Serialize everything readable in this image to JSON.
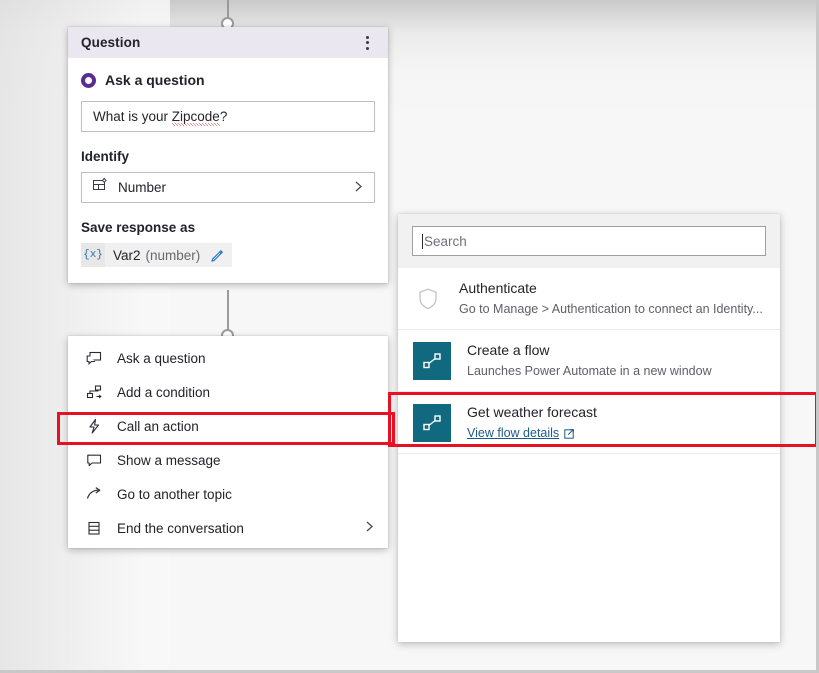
{
  "question_card": {
    "title": "Question",
    "menu_icon": "kebab-menu-icon",
    "ask_option": {
      "label": "Ask a question",
      "selected": true
    },
    "question_text": {
      "value": "What is your Zipcode?",
      "misspelled_word": "Zipcode"
    },
    "identify": {
      "label": "Identify",
      "selected_value": "Number",
      "icon": "entity-grid-icon",
      "chevron": "chevron-right-icon"
    },
    "save_response": {
      "label": "Save response as",
      "badge": "{x}",
      "variable_name": "Var2",
      "variable_type": "(number)",
      "edit_icon": "pencil-icon"
    }
  },
  "node_menu": {
    "items": [
      {
        "label": "Ask a question",
        "icon": "question-bubble-icon",
        "has_submenu": false,
        "highlighted": false
      },
      {
        "label": "Add a condition",
        "icon": "branch-condition-icon",
        "has_submenu": false,
        "highlighted": false
      },
      {
        "label": "Call an action",
        "icon": "lightning-bolt-icon",
        "has_submenu": false,
        "highlighted": true
      },
      {
        "label": "Show a message",
        "icon": "message-bubble-icon",
        "has_submenu": false,
        "highlighted": false
      },
      {
        "label": "Go to another topic",
        "icon": "arrow-redirect-icon",
        "has_submenu": false,
        "highlighted": false
      },
      {
        "label": "End the conversation",
        "icon": "end-list-icon",
        "has_submenu": true,
        "highlighted": false
      }
    ]
  },
  "action_flyout": {
    "search": {
      "placeholder": "Search",
      "value": ""
    },
    "items": [
      {
        "title": "Authenticate",
        "subtitle": "Go to Manage > Authentication to connect an Identity...",
        "icon": "shield-icon",
        "icon_style": "outline",
        "highlighted": false
      },
      {
        "title": "Create a flow",
        "subtitle": "Launches Power Automate in a new window",
        "icon": "power-automate-icon",
        "icon_style": "tile",
        "highlighted": false
      },
      {
        "title": "Get weather forecast",
        "link_label": "View flow details",
        "link_icon": "external-link-icon",
        "icon": "power-automate-icon",
        "icon_style": "tile",
        "highlighted": true
      }
    ]
  },
  "colors": {
    "accent_purple": "#5c2d91",
    "flow_teal": "#10697f",
    "annotation_red": "#e81123",
    "link_blue": "#1e5a8a",
    "header_lavender": "#eae7f1",
    "canvas_gray": "#f7f7f7"
  }
}
